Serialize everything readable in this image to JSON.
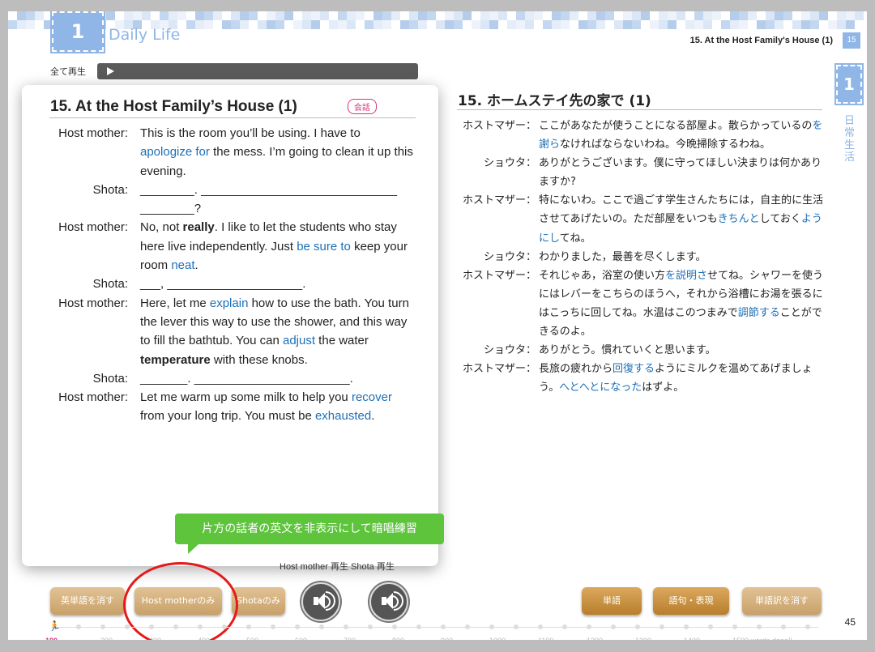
{
  "header": {
    "chapter_number": "1",
    "chapter_title": "Daily Life",
    "section_title": "15. At the Host Family's House (1)",
    "page_badge": "15",
    "side_tab_number": "1",
    "side_label": "日常生活"
  },
  "play_all_label": "全て再生",
  "english": {
    "title": "15. At the Host Family’s House (1)",
    "badge": "会話"
  },
  "japanese": {
    "title": "15. ホームステイ先の家で (1)"
  },
  "tooltip": "片方の話者の英文を非表示にして暗唱練習",
  "under_text": "Host mother 再生  Shota 再生",
  "buttons": {
    "hide_english": "英単語を消す",
    "host_mother_only": "Host motherのみ",
    "shota_only": "Shotaのみ",
    "vocab": "単語",
    "phrases": "語句・表現",
    "hide_translation": "単語訳を消す"
  },
  "ruler": {
    "runner_value": "100",
    "ticks": [
      "200",
      "300",
      "400",
      "500",
      "600",
      "700",
      "800",
      "900",
      "1000",
      "1100",
      "1200",
      "1300",
      "1400",
      "1500 words done!!"
    ]
  },
  "page_number": "45",
  "colors": {
    "accent": "#8fb6e6",
    "highlight": "#1d6fb8",
    "tooltip": "#5dc43c",
    "circle": "#e51a1a"
  }
}
